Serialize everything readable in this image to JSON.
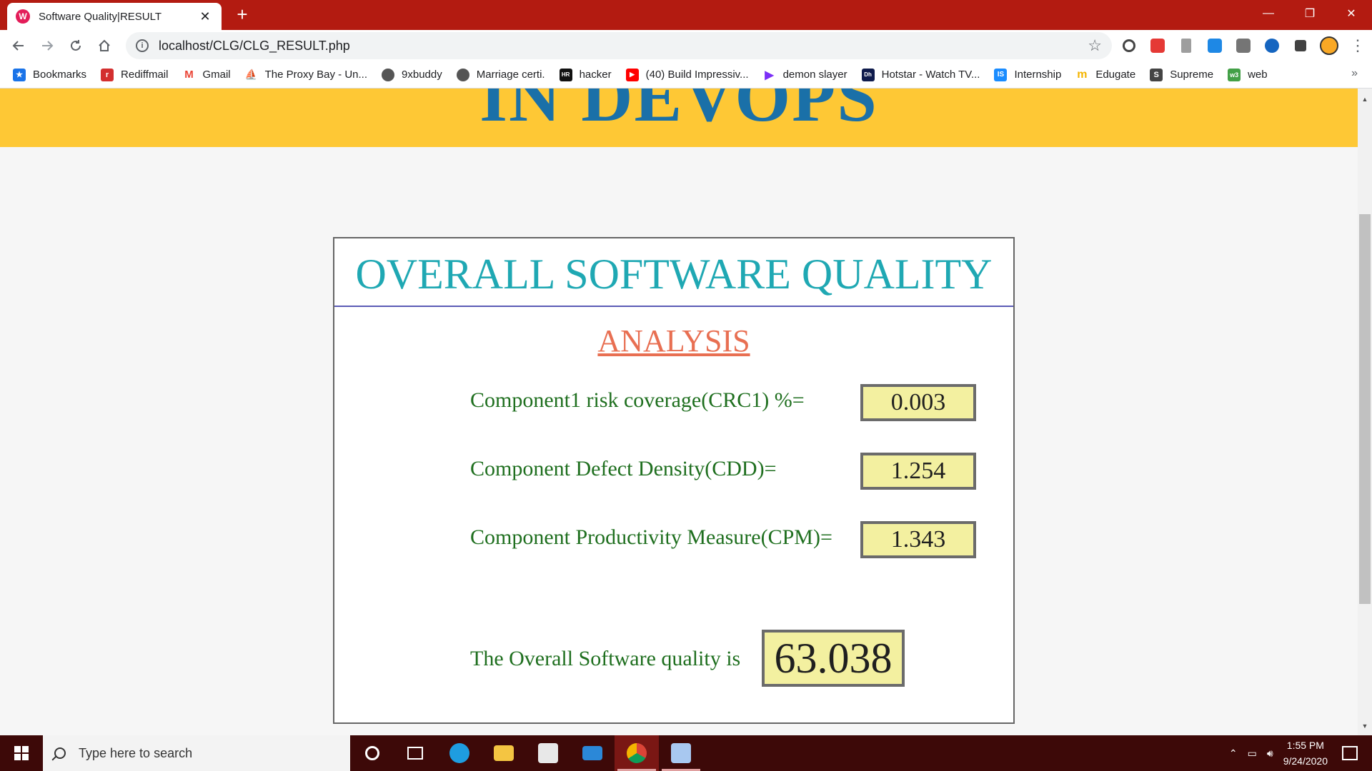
{
  "browser": {
    "tab_title": "Software Quality|RESULT",
    "tab_favicon_letter": "W",
    "tab_close": "✕",
    "new_tab": "+",
    "url": "localhost/CLG/CLG_RESULT.php",
    "window_controls": [
      "—",
      "❐",
      "✕"
    ],
    "bookmarks": [
      {
        "label": "Bookmarks",
        "icon": "star-icon",
        "color": "#1a73e8"
      },
      {
        "label": "Rediffmail",
        "icon": "rediff-icon",
        "color": "#d32f2f"
      },
      {
        "label": "Gmail",
        "icon": "gmail-icon",
        "color": "#ea4335"
      },
      {
        "label": "The Proxy Bay - Un...",
        "icon": "ship-icon",
        "color": "#333333"
      },
      {
        "label": "9xbuddy",
        "icon": "globe-icon",
        "color": "#555555"
      },
      {
        "label": "Marriage certi.",
        "icon": "globe-icon",
        "color": "#555555"
      },
      {
        "label": "hacker",
        "icon": "hackerrank-icon",
        "color": "#111111"
      },
      {
        "label": "(40) Build Impressiv...",
        "icon": "youtube-icon",
        "color": "#ff0000"
      },
      {
        "label": "demon slayer",
        "icon": "play-icon",
        "color": "#7b2ff7"
      },
      {
        "label": "Hotstar - Watch TV...",
        "icon": "hotstar-icon",
        "color": "#0f1b4c"
      },
      {
        "label": "Internship",
        "icon": "internshala-icon",
        "color": "#1a8cff"
      },
      {
        "label": "Edugate",
        "icon": "edugate-icon",
        "color": "#f4b400"
      },
      {
        "label": "Supreme",
        "icon": "supreme-icon",
        "color": "#444444"
      },
      {
        "label": "web",
        "icon": "web-icon",
        "color": "#43a047"
      }
    ],
    "bookmarks_more": "»"
  },
  "page": {
    "banner_text": "IN DEVOPS",
    "title": "OVERALL SOFTWARE QUALITY",
    "subtitle": "ANALYSIS",
    "metrics": [
      {
        "label": "Component1 risk coverage(CRC1) %=",
        "value": "0.003"
      },
      {
        "label": "Component Defect Density(CDD)=",
        "value": "1.254"
      },
      {
        "label": "Component Productivity Measure(CPM)=",
        "value": "1.343"
      }
    ],
    "overall_label": "The Overall Software quality is",
    "overall_value": "63.038"
  },
  "taskbar": {
    "search_placeholder": "Type here to search",
    "time": "1:55 PM",
    "date": "9/24/2020"
  },
  "colors": {
    "tabbar": "#b31b11",
    "banner": "#fec835",
    "title": "#1fa8b3",
    "analysis": "#e86f52",
    "metric_label": "#1f6f1f",
    "value_box": "#f3f0a0"
  }
}
